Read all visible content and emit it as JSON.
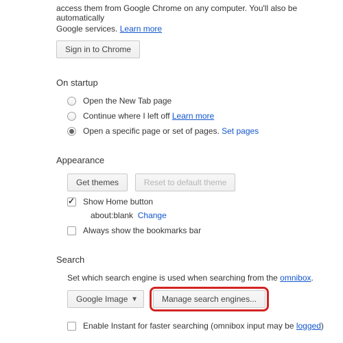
{
  "top": {
    "desc_line1": "access them from Google Chrome on any computer. You'll also be automatically",
    "desc_line2_prefix": "Google services. ",
    "learn_more": "Learn more",
    "sign_in_btn": "Sign in to Chrome"
  },
  "startup": {
    "title": "On startup",
    "option_newtab": "Open the New Tab page",
    "option_continue_prefix": "Continue where I left off ",
    "option_continue_link": "Learn more",
    "option_specific_prefix": "Open a specific page or set of pages.  ",
    "option_specific_link": "Set pages",
    "selected": "specific"
  },
  "appearance": {
    "title": "Appearance",
    "get_themes_btn": "Get themes",
    "reset_theme_btn": "Reset to default theme",
    "show_home_label": "Show Home button",
    "home_value": "about:blank",
    "change_link": "Change",
    "always_bookmarks": "Always show the bookmarks bar",
    "show_home_checked": true,
    "always_bookmarks_checked": false
  },
  "search": {
    "title": "Search",
    "desc_prefix": "Set which search engine is used when searching from the ",
    "omnibox_link": "omnibox",
    "desc_suffix": ".",
    "engine_selected": "Google Image",
    "manage_btn": "Manage search engines...",
    "instant_prefix": "Enable Instant for faster searching (omnibox input may be ",
    "instant_link": "logged",
    "instant_suffix": ")",
    "instant_checked": false
  }
}
